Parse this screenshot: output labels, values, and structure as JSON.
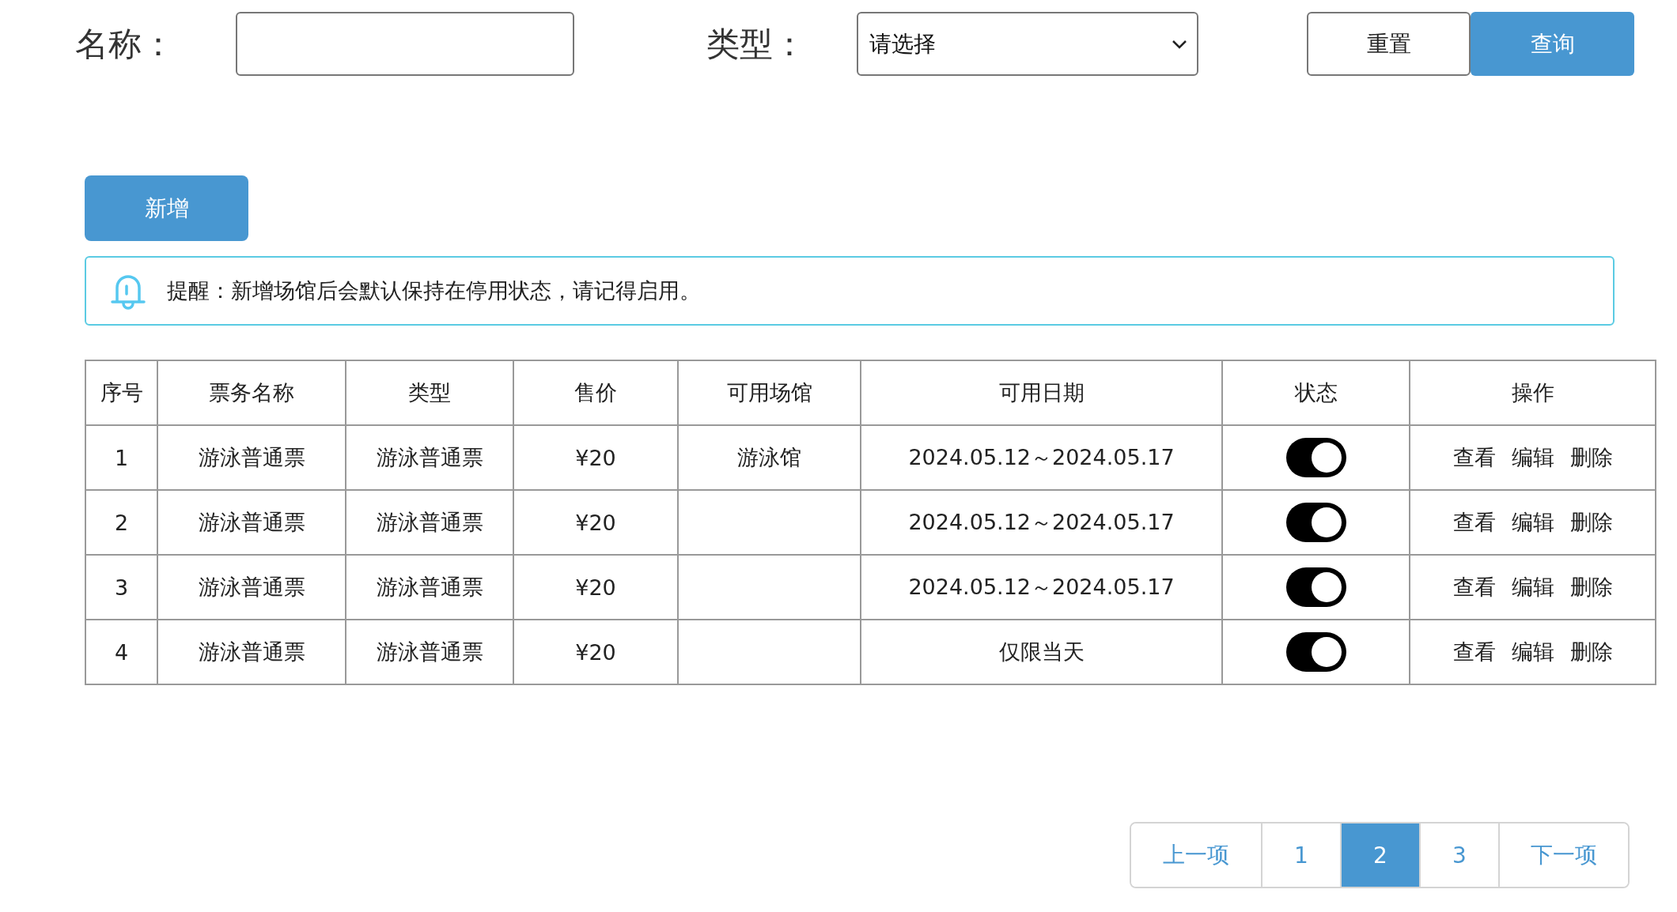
{
  "filters": {
    "name": {
      "label": "名称："
    },
    "type": {
      "label": "类型：",
      "value": "请选择"
    }
  },
  "buttons": [
    {
      "label": "重置",
      "kind": "secondary"
    },
    {
      "label": "查询",
      "kind": "primary"
    }
  ],
  "add_button": "新增",
  "notice": "提醒：新增场馆后会默认保持在停用状态，请记得启用。",
  "table": {
    "columns": [
      "序号",
      "票务名称",
      "类型",
      "售价",
      "可用场馆",
      "可用日期",
      "状态",
      "操作"
    ],
    "rows": [
      {
        "no": "1",
        "name": "游泳普通票",
        "type": "游泳普通票",
        "price": "¥20",
        "venue": "游泳馆",
        "dates": "2024.05.12～2024.05.17",
        "on": true,
        "actions": [
          "查看",
          "编辑",
          "删除"
        ]
      },
      {
        "no": "2",
        "name": "游泳普通票",
        "type": "游泳普通票",
        "price": "¥20",
        "dates": "2024.05.12～2024.05.17",
        "on": true,
        "actions": [
          "查看",
          "编辑",
          "删除"
        ]
      },
      {
        "no": "3",
        "name": "游泳普通票",
        "type": "游泳普通票",
        "price": "¥20",
        "dates": "2024.05.12～2024.05.17",
        "on": true,
        "actions": [
          "查看",
          "编辑",
          "删除"
        ]
      },
      {
        "no": "4",
        "name": "游泳普通票",
        "type": "游泳普通票",
        "price": "¥20",
        "dates": "仅限当天",
        "on": true,
        "actions": [
          "查看",
          "编辑",
          "删除"
        ]
      }
    ]
  },
  "pagination": {
    "prev": "上一项",
    "pages": [
      {
        "label": "1",
        "selected": false
      },
      {
        "label": "2",
        "selected": true
      },
      {
        "label": "3",
        "selected": false
      }
    ],
    "next": "下一项"
  }
}
